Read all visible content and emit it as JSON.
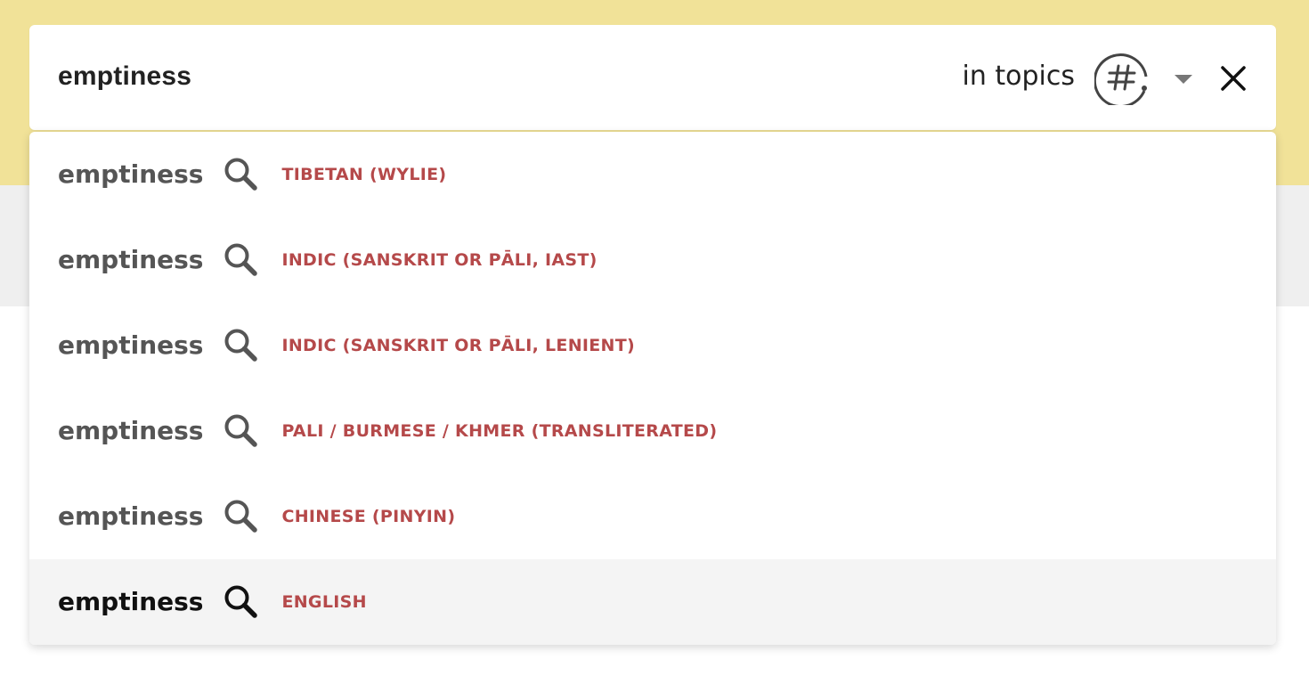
{
  "search": {
    "query": "emptiness",
    "scope_label": "in topics",
    "scope_icon": "hashtag-topic-icon",
    "caret_icon": "chevron-down-icon",
    "close_icon": "close-icon"
  },
  "dropdown": {
    "items": [
      {
        "term": "emptiness",
        "language": "TIBETAN (WYLIE)",
        "active": false
      },
      {
        "term": "emptiness",
        "language": "INDIC (SANSKRIT OR PĀLI, IAST)",
        "active": false
      },
      {
        "term": "emptiness",
        "language": "INDIC (SANSKRIT OR PĀLI, LENIENT)",
        "active": false
      },
      {
        "term": "emptiness",
        "language": "PALI / BURMESE / KHMER (TRANSLITERATED)",
        "active": false
      },
      {
        "term": "emptiness",
        "language": "CHINESE (PINYIN)",
        "active": false
      },
      {
        "term": "emptiness",
        "language": "ENGLISH",
        "active": true
      }
    ]
  },
  "colors": {
    "header_background": "#f1e298",
    "subheader_background": "#efefef",
    "language_label": "#b5494a",
    "active_row": "#f4f4f4"
  }
}
